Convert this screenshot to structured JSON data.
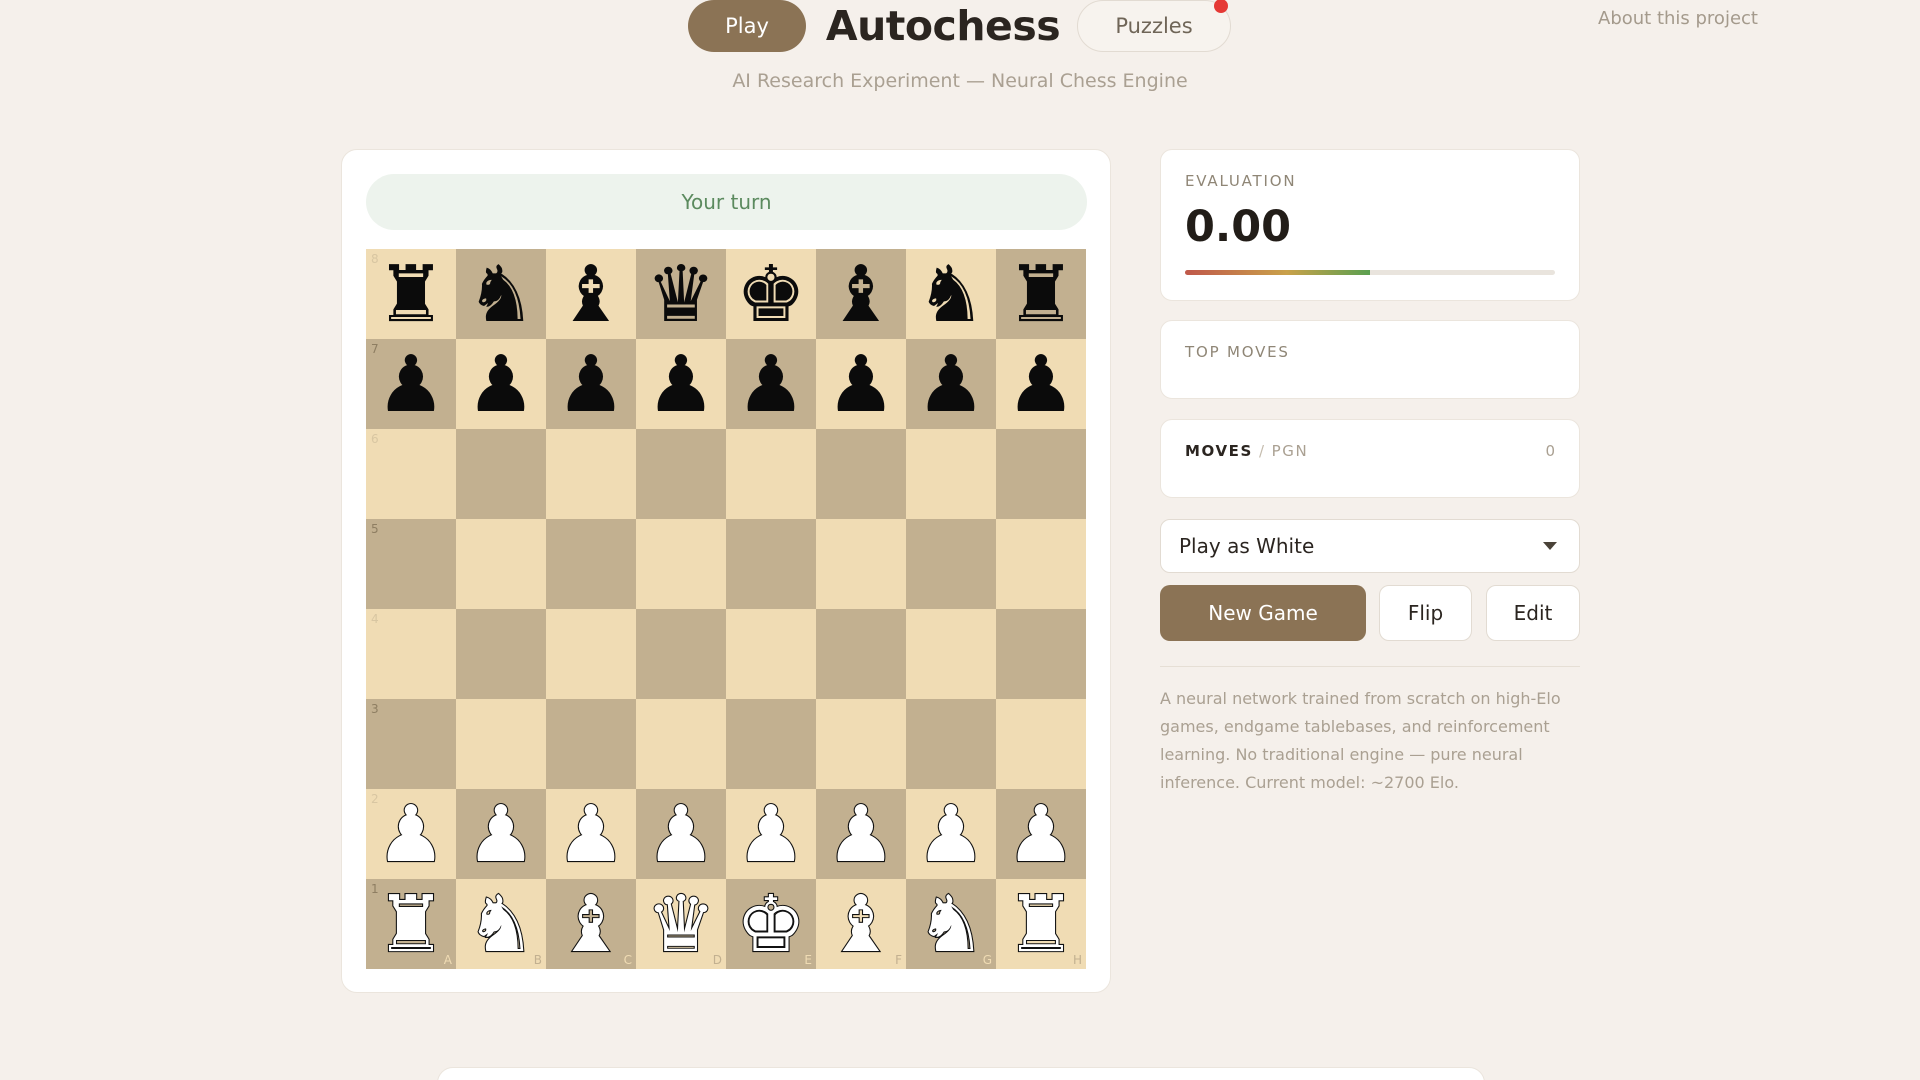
{
  "header": {
    "play_label": "Play",
    "title": "Autochess",
    "puzzles_label": "Puzzles",
    "about_label": "About this project",
    "subtitle": "AI Research Experiment — Neural Chess Engine"
  },
  "game": {
    "status": "Your turn",
    "ranks": [
      "8",
      "7",
      "6",
      "5",
      "4",
      "3",
      "2",
      "1"
    ],
    "files": [
      "A",
      "B",
      "C",
      "D",
      "E",
      "F",
      "G",
      "H"
    ],
    "board": [
      [
        "bR",
        "bN",
        "bB",
        "bQ",
        "bK",
        "bB",
        "bN",
        "bR"
      ],
      [
        "bP",
        "bP",
        "bP",
        "bP",
        "bP",
        "bP",
        "bP",
        "bP"
      ],
      [
        "",
        "",
        "",
        "",
        "",
        "",
        "",
        ""
      ],
      [
        "",
        "",
        "",
        "",
        "",
        "",
        "",
        ""
      ],
      [
        "",
        "",
        "",
        "",
        "",
        "",
        "",
        ""
      ],
      [
        "",
        "",
        "",
        "",
        "",
        "",
        "",
        ""
      ],
      [
        "wP",
        "wP",
        "wP",
        "wP",
        "wP",
        "wP",
        "wP",
        "wP"
      ],
      [
        "wR",
        "wN",
        "wB",
        "wQ",
        "wK",
        "wB",
        "wN",
        "wR"
      ]
    ]
  },
  "evaluation": {
    "label": "EVALUATION",
    "value": "0.00",
    "bar_fraction": 0.5
  },
  "top_moves": {
    "label": "TOP MOVES"
  },
  "moves": {
    "label": "MOVES",
    "separator": "/",
    "pgn_label": "PGN",
    "count": "0"
  },
  "controls": {
    "side_select": "Play as White",
    "new_game_label": "New Game",
    "flip_label": "Flip",
    "edit_label": "Edit"
  },
  "about_text": "A neural network trained from scratch on high-Elo games, endgame tablebases, and reinforcement learning. No traditional engine — pure neural inference. Current model: ~2700 Elo.",
  "colors": {
    "accent": "#8b7355",
    "background": "#f5f0eb",
    "light_square": "#f0dcb4",
    "dark_square": "#c2b090",
    "turn_text": "#5b8a5e",
    "notification": "#e53935"
  }
}
